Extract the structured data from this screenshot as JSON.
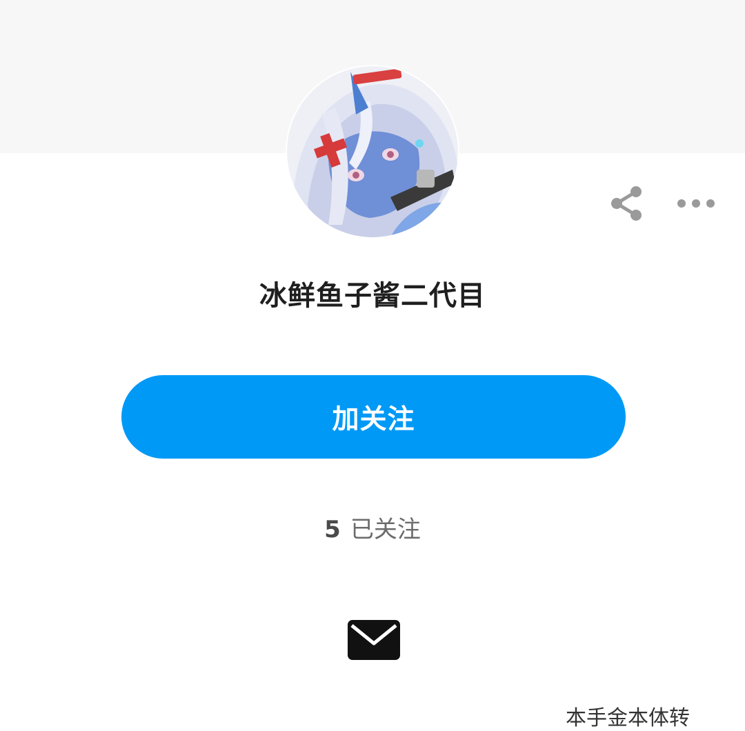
{
  "profile": {
    "username": "冰鲜鱼子酱二代目",
    "follow_button_label": "加关注",
    "following_count": "5",
    "following_label": "已关注",
    "bottom_partial_text": "本手金本体转"
  },
  "icons": {
    "share": "share-icon",
    "more": "more-horizontal-icon",
    "message": "envelope-icon"
  },
  "colors": {
    "accent": "#0099f6",
    "cover": "#f7f7f7"
  }
}
